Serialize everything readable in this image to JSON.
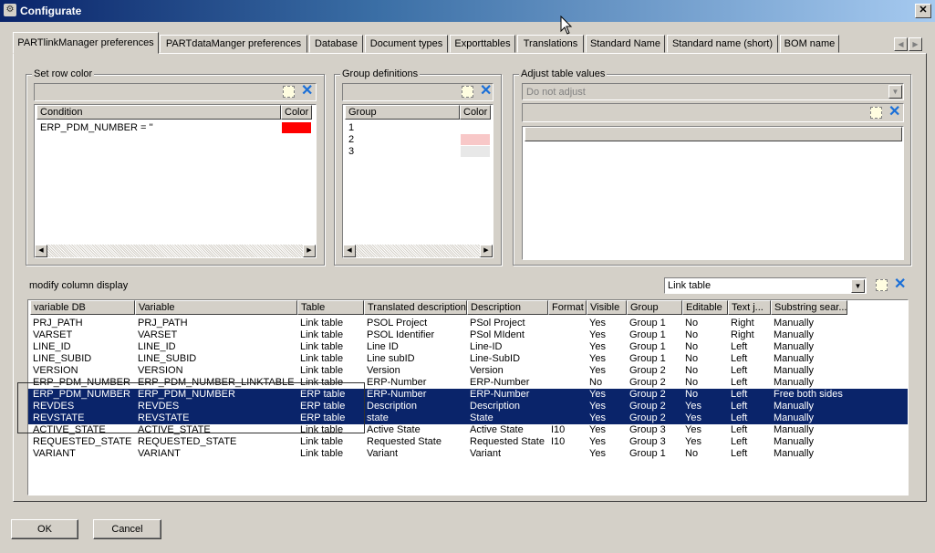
{
  "window": {
    "title": "Configurate"
  },
  "tabs": [
    "PARTlinkManager preferences",
    "PARTdataManger preferences",
    "Database",
    "Document types",
    "Exporttables",
    "Translations",
    "Standard Name",
    "Standard name (short)",
    "BOM name"
  ],
  "set_row_color": {
    "label": "Set row color",
    "headers": [
      "Condition",
      "Color"
    ],
    "rows": [
      {
        "condition": "ERP_PDM_NUMBER = ''",
        "color": "#ff0000"
      }
    ]
  },
  "group_definitions": {
    "label": "Group definitions",
    "headers": [
      "Group",
      "Color"
    ],
    "rows": [
      {
        "group": "1",
        "color": "#ffffff"
      },
      {
        "group": "2",
        "color": "#f8c8c8"
      },
      {
        "group": "3",
        "color": "#e8e8e8"
      }
    ]
  },
  "adjust_table_values": {
    "label": "Adjust table values",
    "select_value": "Do not adjust"
  },
  "modify_column_display": {
    "label": "modify column display",
    "table_select": "Link table",
    "headers": [
      "variable DB",
      "Variable",
      "Table",
      "Translated description",
      "Description",
      "Format",
      "Visible",
      "Group",
      "Editable",
      "Text j...",
      "Substring sear..."
    ],
    "rows": [
      [
        "PRJ_PATH",
        "PRJ_PATH",
        "Link table",
        "PSOL Project",
        "PSol Project",
        "",
        "Yes",
        "Group 1",
        "No",
        "Right",
        "Manually"
      ],
      [
        "VARSET",
        "VARSET",
        "Link table",
        "PSOL Identifier",
        "PSol MIdent",
        "",
        "Yes",
        "Group 1",
        "No",
        "Right",
        "Manually"
      ],
      [
        "LINE_ID",
        "LINE_ID",
        "Link table",
        "Line ID",
        "Line-ID",
        "",
        "Yes",
        "Group 1",
        "No",
        "Left",
        "Manually"
      ],
      [
        "LINE_SUBID",
        "LINE_SUBID",
        "Link table",
        "Line subID",
        "Line-SubID",
        "",
        "Yes",
        "Group 1",
        "No",
        "Left",
        "Manually"
      ],
      [
        "VERSION",
        "VERSION",
        "Link table",
        "Version",
        "Version",
        "",
        "Yes",
        "Group 2",
        "No",
        "Left",
        "Manually"
      ],
      [
        "ERP_PDM_NUMBER",
        "ERP_PDM_NUMBER_LINKTABLE",
        "Link table",
        "ERP-Number",
        "ERP-Number",
        "",
        "No",
        "Group 2",
        "No",
        "Left",
        "Manually"
      ],
      [
        "ERP_PDM_NUMBER",
        "ERP_PDM_NUMBER",
        "ERP table",
        "ERP-Number",
        "ERP-Number",
        "",
        "Yes",
        "Group 2",
        "No",
        "Left",
        "Free both sides"
      ],
      [
        "REVDES",
        "REVDES",
        "ERP table",
        "Description",
        "Description",
        "",
        "Yes",
        "Group 2",
        "Yes",
        "Left",
        "Manually"
      ],
      [
        "REVSTATE",
        "REVSTATE",
        "ERP table",
        "state",
        "State",
        "",
        "Yes",
        "Group 2",
        "Yes",
        "Left",
        "Manually"
      ],
      [
        "ACTIVE_STATE",
        "ACTIVE_STATE",
        "Link table",
        "Active State",
        "Active State",
        "I10",
        "Yes",
        "Group 3",
        "Yes",
        "Left",
        "Manually"
      ],
      [
        "REQUESTED_STATE",
        "REQUESTED_STATE",
        "Link table",
        "Requested State",
        "Requested State",
        "I10",
        "Yes",
        "Group 3",
        "Yes",
        "Left",
        "Manually"
      ],
      [
        "VARIANT",
        "VARIANT",
        "Link table",
        "Variant",
        "Variant",
        "",
        "Yes",
        "Group 1",
        "No",
        "Left",
        "Manually"
      ]
    ],
    "selected_rows": [
      6,
      7,
      8
    ]
  },
  "buttons": {
    "ok": "OK",
    "cancel": "Cancel"
  }
}
